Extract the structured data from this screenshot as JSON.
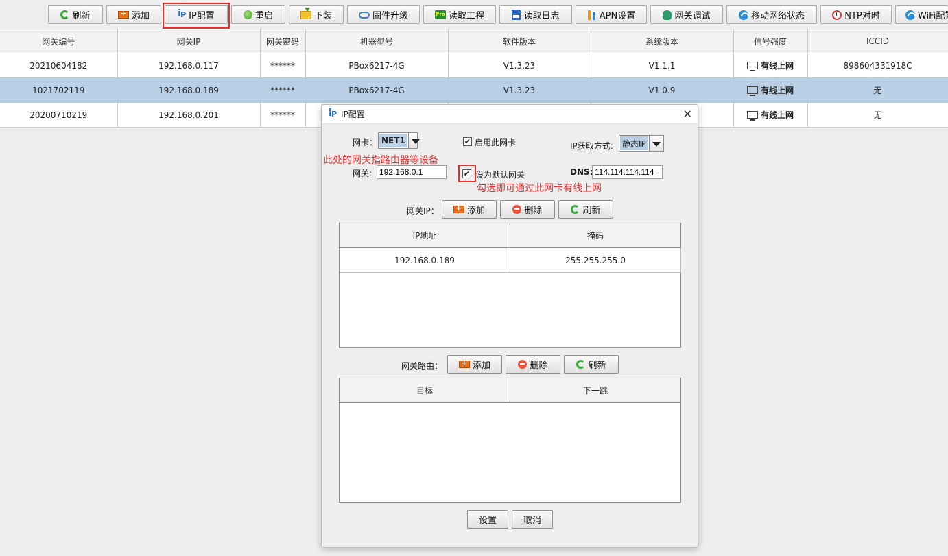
{
  "toolbar": {
    "buttons": [
      {
        "label": "刷新",
        "icon": "refresh-icon"
      },
      {
        "label": "添加",
        "icon": "add-icon"
      },
      {
        "label": "IP配置",
        "icon": "ip-icon"
      },
      {
        "label": "重启",
        "icon": "restart-icon"
      },
      {
        "label": "下装",
        "icon": "download-icon"
      },
      {
        "label": "固件升级",
        "icon": "cloud-icon"
      },
      {
        "label": "读取工程",
        "icon": "pro-icon"
      },
      {
        "label": "读取日志",
        "icon": "log-icon"
      },
      {
        "label": "APN设置",
        "icon": "apn-icon"
      },
      {
        "label": "网关调试",
        "icon": "bug-icon"
      },
      {
        "label": "移动网络状态",
        "icon": "wifi-icon"
      },
      {
        "label": "NTP对时",
        "icon": "clock-icon"
      },
      {
        "label": "WiFi配置",
        "icon": "wifi-icon"
      }
    ]
  },
  "table": {
    "columns": [
      "网关编号",
      "网关IP",
      "网关密码",
      "机器型号",
      "软件版本",
      "系统版本",
      "信号强度",
      "ICCID"
    ],
    "rows": [
      [
        "20210604182",
        "192.168.0.117",
        "******",
        "PBox6217-4G",
        "V1.3.23",
        "V1.1.1",
        "有线上网",
        "898604331918C"
      ],
      [
        "1021702119",
        "192.168.0.189",
        "******",
        "PBox6217-4G",
        "V1.3.23",
        "V1.0.9",
        "有线上网",
        "无"
      ],
      [
        "20200710219",
        "192.168.0.201",
        "******",
        "",
        "",
        "",
        "有线上网",
        "无"
      ]
    ],
    "selected_row": 1
  },
  "dialog": {
    "title": "IP配置",
    "nic_label": "网卡：",
    "nic_value": "NET1",
    "enable_nic_label": "启用此网卡",
    "enable_nic_checked": true,
    "ip_mode_label": "IP获取方式:",
    "ip_mode_value": "静态IP",
    "gateway_label": "网关:",
    "gateway_value": "192.168.0.1",
    "default_gw_label": "设为默认网关",
    "default_gw_checked": true,
    "dns_label": "DNS:",
    "dns_value": "114.114.114.114",
    "gateway_ip_label": "网关IP：",
    "add_label": "添加",
    "delete_label": "删除",
    "refresh_label": "刷新",
    "ip_table_columns": [
      "IP地址",
      "掩码"
    ],
    "ip_table_rows": [
      [
        "192.168.0.189",
        "255.255.255.0"
      ]
    ],
    "route_label": "网关路由：",
    "route_table_columns": [
      "目标",
      "下一跳"
    ],
    "set_label": "设置",
    "cancel_label": "取消"
  },
  "annotations": {
    "note_gateway": "此处的网关指路由器等设备",
    "note_checkbox": "勾选即可通过此网卡有线上网"
  },
  "colors": {
    "highlight": "#e8312f",
    "selected_row": "#b8cfe5"
  }
}
